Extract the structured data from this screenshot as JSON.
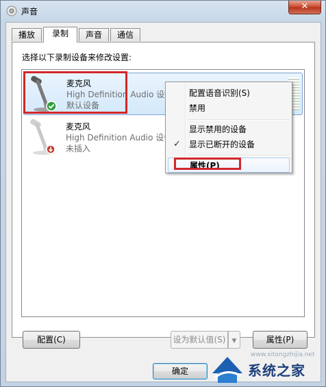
{
  "window": {
    "title": "声音",
    "close_symbol": "✕"
  },
  "tabs": [
    {
      "label": "播放",
      "active": false
    },
    {
      "label": "录制",
      "active": true
    },
    {
      "label": "声音",
      "active": false
    },
    {
      "label": "通信",
      "active": false
    }
  ],
  "instruction": "选择以下录制设备来修改设置:",
  "devices": [
    {
      "name": "麦克风",
      "description": "High Definition Audio 设备",
      "status": "默认设备",
      "icon": "microphone-icon",
      "badge": "check-badge-icon",
      "selected": true
    },
    {
      "name": "麦克风",
      "description": "High Definition Audio 设备",
      "status": "未插入",
      "icon": "microphone-icon",
      "badge": "unplugged-badge-icon",
      "selected": false
    }
  ],
  "context_menu": {
    "items": [
      {
        "label": "配置语音识别(S)",
        "checked": false
      },
      {
        "label": "禁用",
        "checked": false
      },
      {
        "label": "显示禁用的设备",
        "checked": false
      },
      {
        "label": "显示已断开的设备",
        "checked": true
      },
      {
        "label": "属性(P)",
        "checked": false,
        "highlighted": true
      }
    ],
    "check_symbol": "✓"
  },
  "buttons": {
    "configure": "配置(C)",
    "set_default": "设为默认值(S)",
    "properties": "属性(P)",
    "ok": "确定"
  },
  "watermark": {
    "text": "系统之家",
    "url": "www.xitongzhijia.net"
  },
  "colors": {
    "highlight_red": "#d3262a",
    "selection_blue": "#d3e9fb"
  }
}
